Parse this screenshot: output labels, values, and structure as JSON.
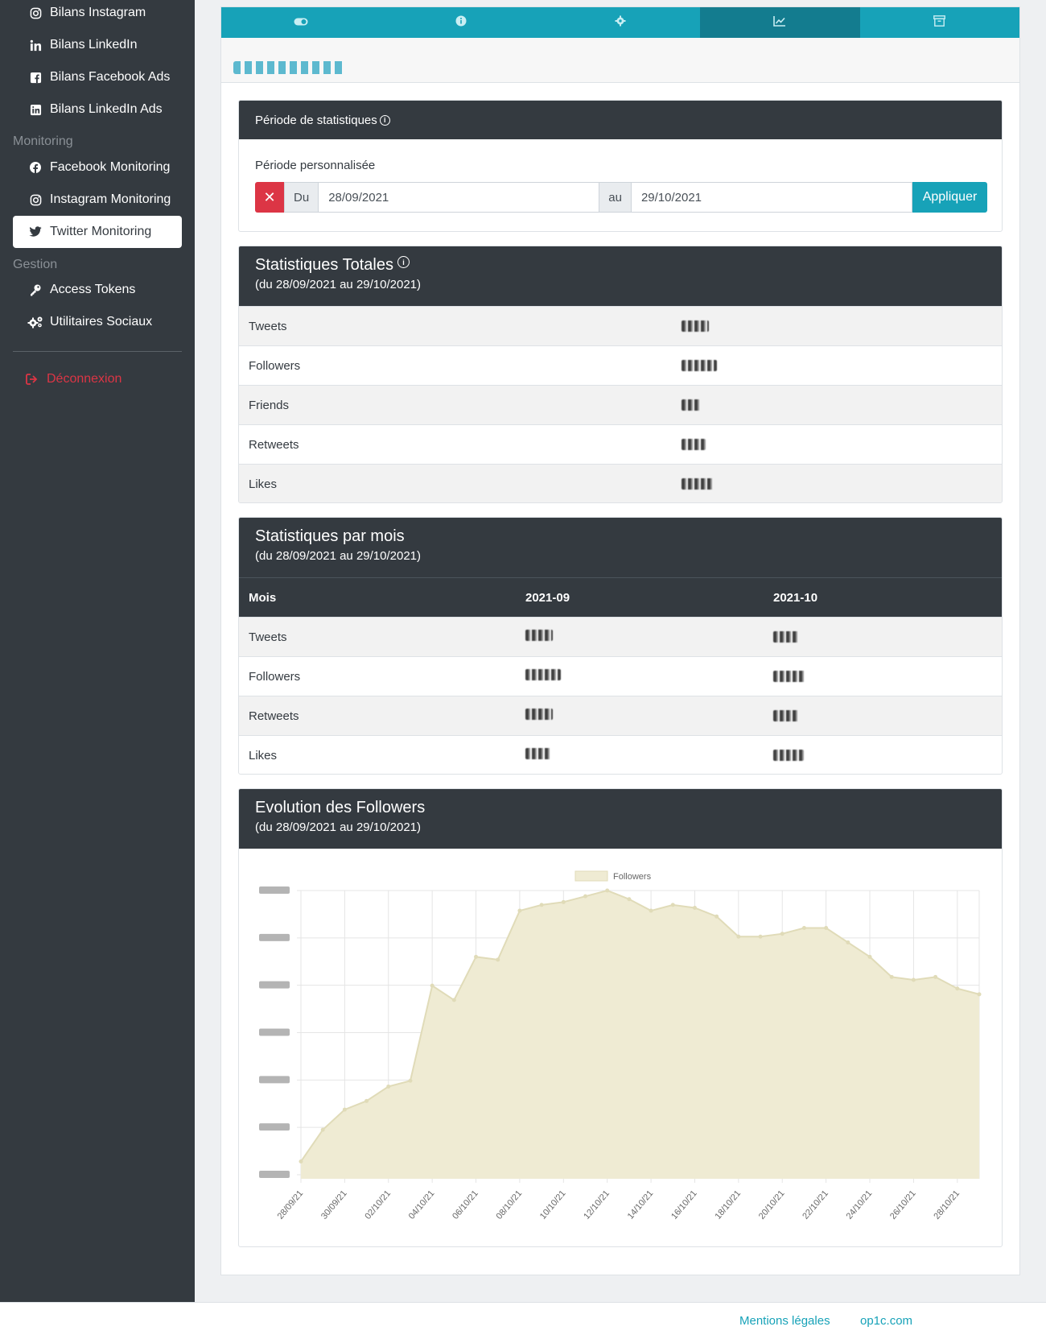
{
  "sidebar": {
    "items_top": [
      {
        "label": "Bilans Instagram",
        "icon": "instagram-icon"
      },
      {
        "label": "Bilans LinkedIn",
        "icon": "linkedin-icon"
      },
      {
        "label": "Bilans Facebook Ads",
        "icon": "facebook-square-icon"
      },
      {
        "label": "Bilans LinkedIn Ads",
        "icon": "linkedin-square-icon"
      }
    ],
    "monitoring_header": "Monitoring",
    "monitoring_items": [
      {
        "label": "Facebook Monitoring",
        "icon": "facebook-icon"
      },
      {
        "label": "Instagram Monitoring",
        "icon": "instagram-icon"
      },
      {
        "label": "Twitter Monitoring",
        "icon": "twitter-icon",
        "active": true
      }
    ],
    "gestion_header": "Gestion",
    "gestion_items": [
      {
        "label": "Access Tokens",
        "icon": "key-icon"
      },
      {
        "label": "Utilitaires Sociaux",
        "icon": "cogs-icon"
      }
    ],
    "logout_label": "Déconnexion"
  },
  "tabs": [
    {
      "icon": "toggle-icon"
    },
    {
      "icon": "info-icon"
    },
    {
      "icon": "gear-icon"
    },
    {
      "icon": "chart-line-icon",
      "active": true
    },
    {
      "icon": "archive-icon"
    }
  ],
  "period_panel": {
    "title": "Période de statistiques",
    "custom_label": "Période personnalisée",
    "from_label": "Du",
    "from_value": "28/09/2021",
    "to_label": "au",
    "to_value": "29/10/2021",
    "apply_label": "Appliquer"
  },
  "totals_panel": {
    "title": "Statistiques Totales",
    "subtitle": "(du 28/09/2021 au 29/10/2021)",
    "rows": [
      "Tweets",
      "Followers",
      "Friends",
      "Retweets",
      "Likes"
    ]
  },
  "monthly_panel": {
    "title": "Statistiques par mois",
    "subtitle": "(du 28/09/2021 au 29/10/2021)",
    "headers": [
      "Mois",
      "2021-09",
      "2021-10"
    ],
    "rows": [
      "Tweets",
      "Followers",
      "Retweets",
      "Likes"
    ]
  },
  "evolution_panel": {
    "title": "Evolution des Followers",
    "subtitle": "(du 28/09/2021 au 29/10/2021)"
  },
  "chart_data": {
    "type": "area",
    "series": [
      {
        "name": "Followers"
      }
    ],
    "x": [
      "28/09/21",
      "29/09/21",
      "30/09/21",
      "01/10/21",
      "02/10/21",
      "03/10/21",
      "04/10/21",
      "05/10/21",
      "06/10/21",
      "07/10/21",
      "08/10/21",
      "09/10/21",
      "10/10/21",
      "11/10/21",
      "12/10/21",
      "13/10/21",
      "14/10/21",
      "15/10/21",
      "16/10/21",
      "17/10/21",
      "18/10/21",
      "19/10/21",
      "20/10/21",
      "21/10/21",
      "22/10/21",
      "23/10/21",
      "24/10/21",
      "25/10/21",
      "26/10/21",
      "27/10/21",
      "28/10/21",
      "29/10/21"
    ],
    "x_tick_labels": [
      "28/09/21",
      "30/09/21",
      "02/10/21",
      "04/10/21",
      "06/10/21",
      "08/10/21",
      "10/10/21",
      "12/10/21",
      "14/10/21",
      "16/10/21",
      "18/10/21",
      "20/10/21",
      "22/10/21",
      "24/10/21",
      "26/10/21",
      "28/10/21"
    ],
    "relative_values": [
      0.06,
      0.17,
      0.24,
      0.27,
      0.32,
      0.34,
      0.67,
      0.62,
      0.77,
      0.76,
      0.93,
      0.95,
      0.96,
      0.98,
      1.0,
      0.97,
      0.93,
      0.95,
      0.94,
      0.91,
      0.84,
      0.84,
      0.85,
      0.87,
      0.87,
      0.82,
      0.77,
      0.7,
      0.69,
      0.7,
      0.66,
      0.64
    ],
    "y_tick_count": 7,
    "grid": true,
    "legend": "top-center",
    "fill_color": "#efebd3",
    "line_color": "#e0dbb8"
  },
  "footer": {
    "links": [
      "Mentions légales",
      "op1c.com"
    ]
  }
}
